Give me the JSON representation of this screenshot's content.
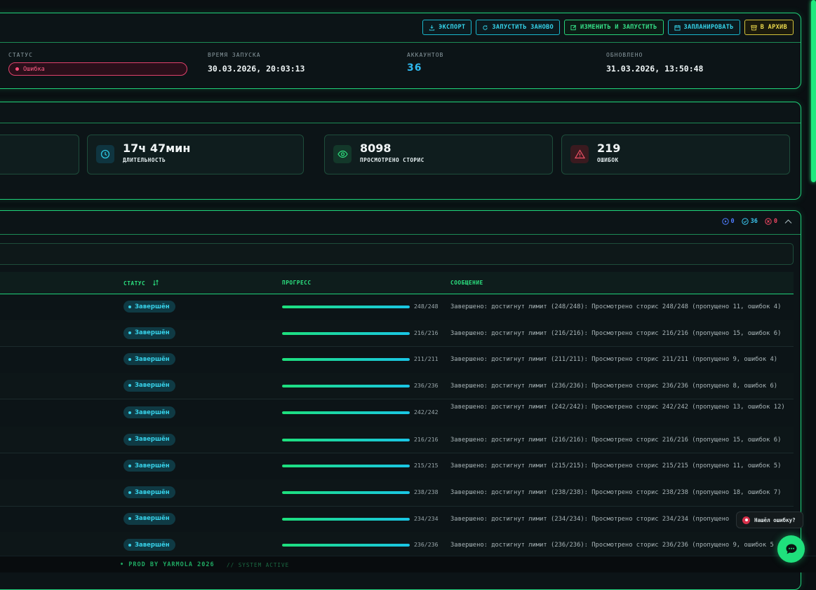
{
  "toolbar": {
    "export_label": "ЭКСПОРТ",
    "restart_label": "ЗАПУСТИТЬ ЗАНОВО",
    "edit_run_label": "ИЗМЕНИТЬ И ЗАПУСТИТЬ",
    "schedule_label": "ЗАПЛАНИРОВАТЬ",
    "archive_label": "В АРХИВ"
  },
  "info": {
    "status_label": "СТАТУС",
    "status_value": "Ошибка",
    "start_label": "ВРЕМЯ ЗАПУСКА",
    "start_value": "30.03.2026, 20:03:13",
    "accounts_label": "АККАУНТОВ",
    "accounts_value": "36",
    "updated_label": "ОБНОВЛЕНО",
    "updated_value": "31.03.2026, 13:50:48"
  },
  "stats": {
    "duration_value": "17ч 47мин",
    "duration_label": "ДЛИТЕЛЬНОСТЬ",
    "stories_value": "8098",
    "stories_label": "ПРОСМОТРЕНО СТОРИС",
    "errors_value": "219",
    "errors_label": "ОШИБОК"
  },
  "counters": {
    "running": "0",
    "done": "36",
    "failed": "0"
  },
  "colors": {
    "accent": "#1fd27a",
    "cyan": "#19c6e6",
    "error": "#e0416b",
    "warn": "#ecd94c"
  },
  "table": {
    "headers": {
      "status": "СТАТУС",
      "progress": "ПРОГРЕСС",
      "message": "СООБЩЕНИЕ"
    },
    "rows": [
      {
        "status": "Завершён",
        "progress": "248/248",
        "fraction": 1.0,
        "message": "Завершено: достигнут лимит (248/248): Просмотрено сторис 248/248 (пропущено 11, ошибок 4)"
      },
      {
        "status": "Завершён",
        "progress": "216/216",
        "fraction": 1.0,
        "message": "Завершено: достигнут лимит (216/216): Просмотрено сторис 216/216 (пропущено 15, ошибок 6)"
      },
      {
        "status": "Завершён",
        "progress": "211/211",
        "fraction": 1.0,
        "message": "Завершено: достигнут лимит (211/211): Просмотрено сторис 211/211 (пропущено 9, ошибок 4)"
      },
      {
        "status": "Завершён",
        "progress": "236/236",
        "fraction": 1.0,
        "message": "Завершено: достигнут лимит (236/236): Просмотрено сторис 236/236 (пропущено 8, ошибок 6)"
      },
      {
        "status": "Завершён",
        "progress": "242/242",
        "fraction": 1.0,
        "message": "Завершено: достигнут лимит (242/242): Просмотрено сторис 242/242 (пропущено 13, ошибок 12)"
      },
      {
        "status": "Завершён",
        "progress": "216/216",
        "fraction": 1.0,
        "message": "Завершено: достигнут лимит (216/216): Просмотрено сторис 216/216 (пропущено 15, ошибок 6)"
      },
      {
        "status": "Завершён",
        "progress": "215/215",
        "fraction": 1.0,
        "message": "Завершено: достигнут лимит (215/215): Просмотрено сторис 215/215 (пропущено 11, ошибок 5)"
      },
      {
        "status": "Завершён",
        "progress": "238/238",
        "fraction": 1.0,
        "message": "Завершено: достигнут лимит (238/238): Просмотрено сторис 238/238 (пропущено 18, ошибок 7)"
      },
      {
        "status": "Завершён",
        "progress": "234/234",
        "fraction": 1.0,
        "message": "Завершено: достигнут лимит (234/234): Просмотрено сторис 234/234 (пропущено"
      },
      {
        "status": "Завершён",
        "progress": "236/236",
        "fraction": 1.0,
        "message": "Завершено: достигнут лимит (236/236): Просмотрено сторис 236/236 (пропущено 9, ошибок 5"
      }
    ]
  },
  "footer": {
    "credit": "PROD BY YARMOLA 2026",
    "system": "// SYSTEM ACTIVE"
  },
  "report": {
    "label": "Нашёл ошибку?"
  }
}
